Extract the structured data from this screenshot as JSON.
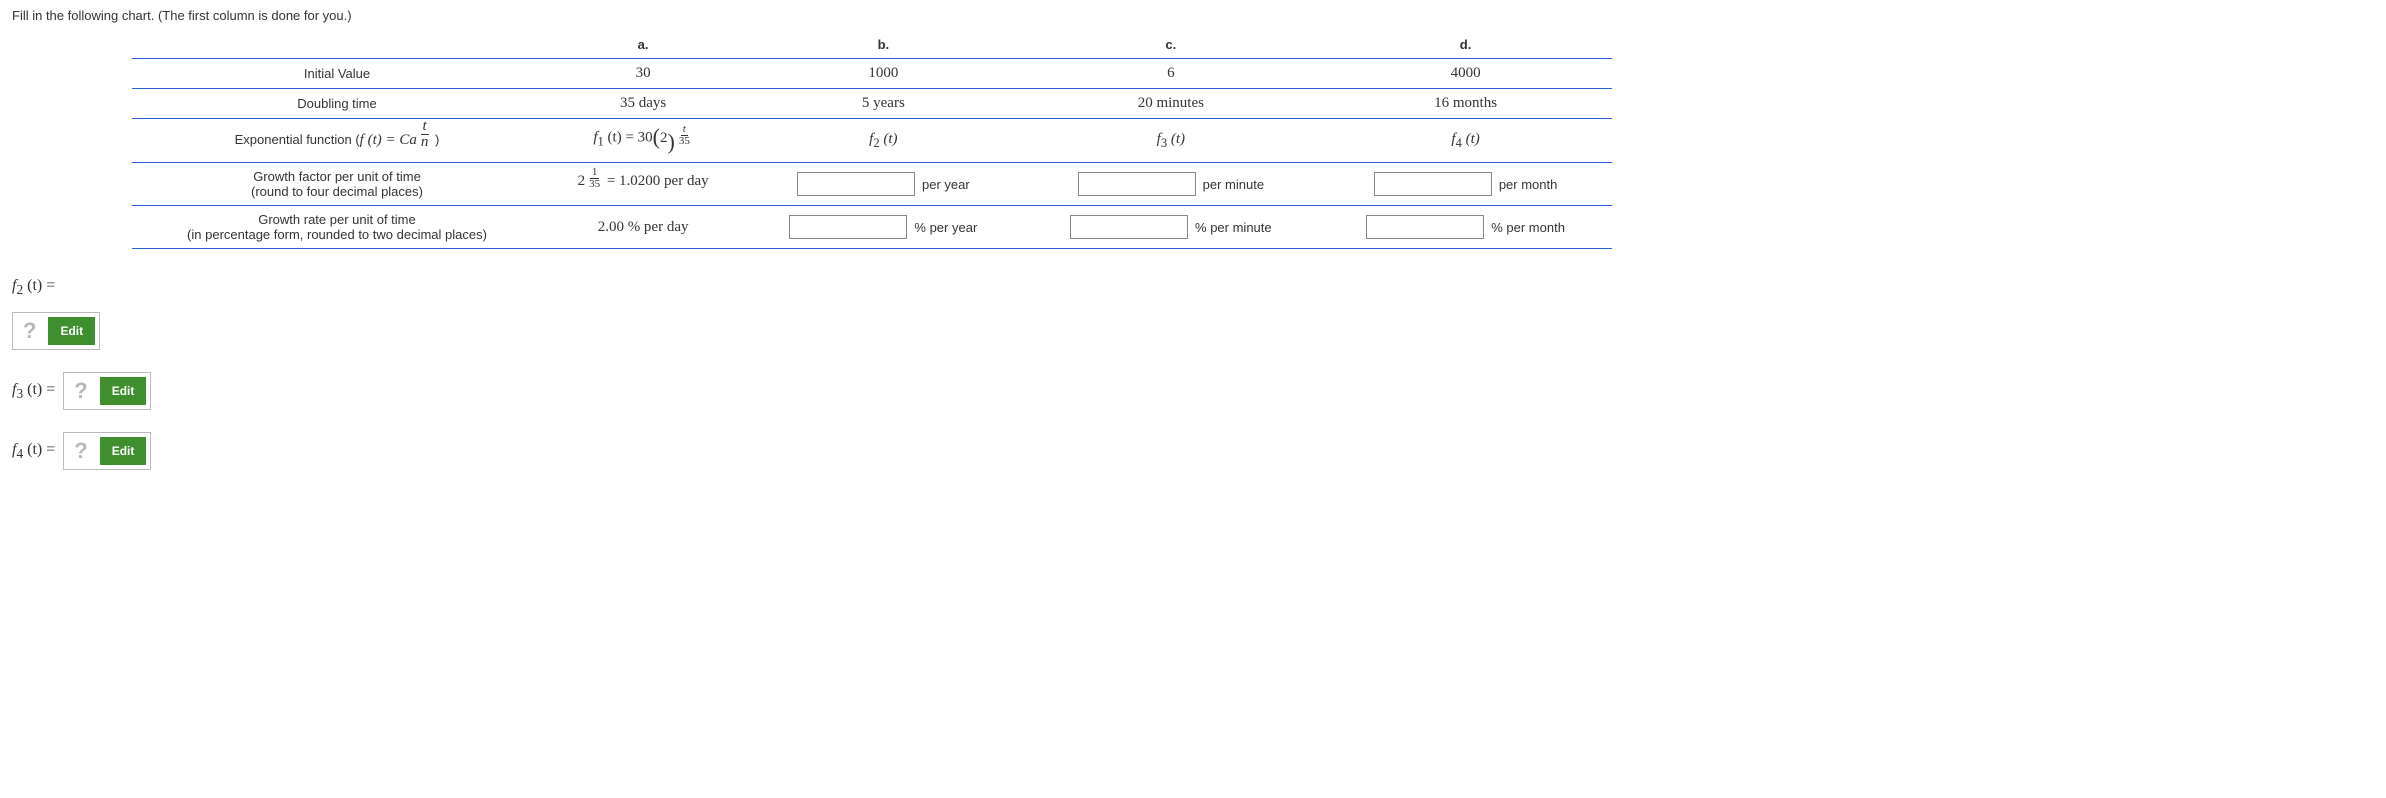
{
  "prompt": "Fill in the following chart. (The first column is done for you.)",
  "columns": {
    "a": "a.",
    "b": "b.",
    "c": "c.",
    "d": "d."
  },
  "rows": {
    "initial": {
      "label": "Initial Value",
      "a": "30",
      "b": "1000",
      "c": "6",
      "d": "4000"
    },
    "doubling": {
      "label": "Doubling time",
      "a": "35 days",
      "b": "5 years",
      "c": "20 minutes",
      "d": "16 months"
    },
    "exp_fn": {
      "label_prefix": "Exponential function (",
      "label_formula_f": "f",
      "label_formula_t": " (t) = Ca",
      "label_suffix": " )",
      "a_prefix": "f",
      "a_sub": "1",
      "a_mid": " (t) = 30",
      "a_base": "2",
      "a_frac_num": "t",
      "a_frac_den": "35",
      "b_f": "f",
      "b_sub": "2",
      "b_t": " (t)",
      "c_f": "f",
      "c_sub": "3",
      "c_t": " (t)",
      "d_f": "f",
      "d_sub": "4",
      "d_t": " (t)"
    },
    "growth_factor": {
      "label_l1": "Growth factor per unit of time",
      "label_l2": "(round to four decimal places)",
      "a_base": "2",
      "a_frac_num": "1",
      "a_frac_den": "35",
      "a_eq": " = 1.0200 per day",
      "b_unit": "per year",
      "c_unit": "per minute",
      "d_unit": "per month"
    },
    "growth_rate": {
      "label_l1": "Growth rate per unit of time",
      "label_l2": "(in percentage form, rounded to two decimal places)",
      "a": "2.00 % per day",
      "b_unit": "% per year",
      "c_unit": "% per minute",
      "d_unit": "% per month"
    }
  },
  "answers": {
    "f2_label": "f",
    "f2_sub": "2",
    "f2_rest": " (t) = ",
    "f3_label": "f",
    "f3_sub": "3",
    "f3_rest": " (t) = ",
    "f4_label": "f",
    "f4_sub": "4",
    "f4_rest": " (t) = ",
    "edit": "Edit",
    "q": "?"
  },
  "chart_data": {
    "type": "table",
    "title": "Exponential growth chart",
    "columns": [
      "a",
      "b",
      "c",
      "d"
    ],
    "rows": [
      {
        "name": "Initial Value",
        "values": [
          30,
          1000,
          6,
          4000
        ]
      },
      {
        "name": "Doubling time",
        "values": [
          "35 days",
          "5 years",
          "20 minutes",
          "16 months"
        ]
      },
      {
        "name": "Exponential function f(t)=Ca^(t/n)",
        "values": [
          "f1(t)=30(2)^(t/35)",
          "f2(t)",
          "f3(t)",
          "f4(t)"
        ]
      },
      {
        "name": "Growth factor per unit of time (4 dp)",
        "values": [
          "2^(1/35)=1.0200 per day",
          null,
          null,
          null
        ]
      },
      {
        "name": "Growth rate per unit of time (% 2 dp)",
        "values": [
          "2.00 % per day",
          null,
          null,
          null
        ]
      }
    ]
  }
}
